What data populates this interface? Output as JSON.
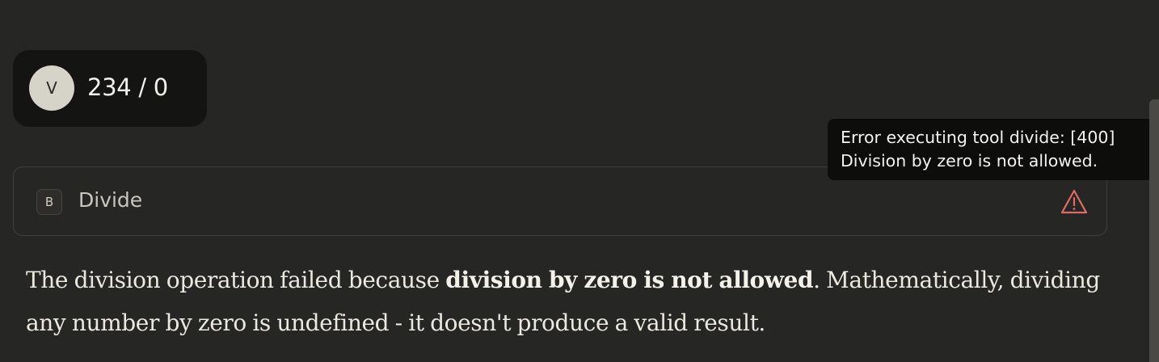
{
  "user_message": {
    "avatar_initial": "V",
    "text": "234 / 0"
  },
  "tool_call": {
    "badge": "B",
    "name": "Divide",
    "status_icon": "warning-triangle-icon",
    "status_color": "#e06b63"
  },
  "tooltip": {
    "line1": "Error executing tool divide: [400]",
    "line2": "Division by zero is not allowed."
  },
  "response": {
    "part1": "The division operation failed because ",
    "bold": "division by zero is not allowed",
    "part2": ". Mathematically, dividing any number by zero is undefined - it doesn't produce a valid result."
  }
}
